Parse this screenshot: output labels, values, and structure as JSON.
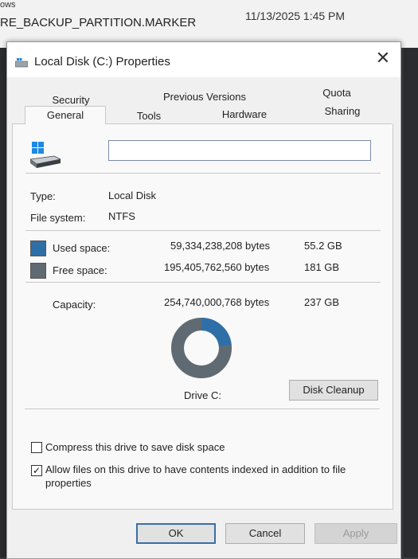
{
  "background": {
    "explorer_fragment": "ows",
    "file_name": "RE_BACKUP_PARTITION.MARKER",
    "file_date": "11/13/2025 1:45 PM"
  },
  "dialog": {
    "title": "Local Disk (C:) Properties",
    "close_glyph": "✕",
    "tabs_row_top": [
      "Security",
      "Previous Versions",
      "Quota"
    ],
    "tabs_row_bottom": [
      "General",
      "Tools",
      "Hardware",
      "Sharing"
    ],
    "active_tab": "General",
    "general": {
      "volume_name_value": "",
      "type_label": "Type:",
      "type_value": "Local Disk",
      "fs_label": "File system:",
      "fs_value": "NTFS",
      "used_label": "Used space:",
      "used_bytes": "59,334,238,208 bytes",
      "used_gb": "55.2 GB",
      "free_label": "Free space:",
      "free_bytes": "195,405,762,560 bytes",
      "free_gb": "181 GB",
      "capacity_label": "Capacity:",
      "capacity_bytes": "254,740,000,768 bytes",
      "capacity_gb": "237 GB",
      "used_fraction": 0.233,
      "drive_label": "Drive C:",
      "cleanup_button": "Disk Cleanup",
      "compress_label": "Compress this drive to save disk space",
      "compress_checked": false,
      "index_label_line1": "Allow files on this drive to have contents indexed in addition to file",
      "index_label_line2": "properties",
      "index_checked": true
    },
    "buttons": {
      "ok": "OK",
      "cancel": "Cancel",
      "apply": "Apply"
    },
    "colors": {
      "used": "#2f6fa8",
      "free": "#5f6a72"
    }
  }
}
